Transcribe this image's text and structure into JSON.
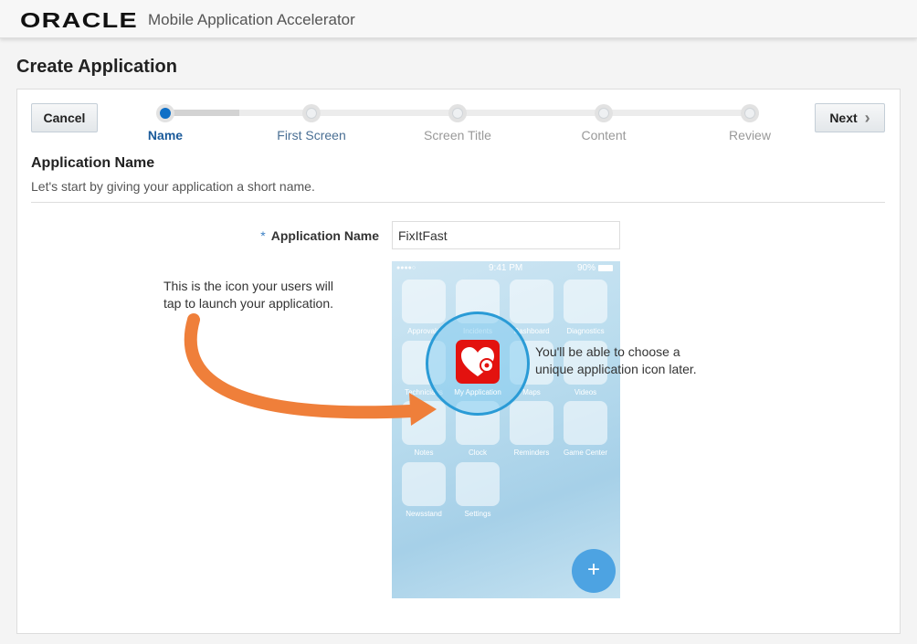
{
  "header": {
    "logo": "ORACLE",
    "title": "Mobile Application Accelerator"
  },
  "page_title": "Create Application",
  "toolbar": {
    "cancel": "Cancel",
    "next": "Next"
  },
  "steps": [
    {
      "label": "Name",
      "active": true
    },
    {
      "label": "First Screen"
    },
    {
      "label": "Screen Title"
    },
    {
      "label": "Content"
    },
    {
      "label": "Review"
    }
  ],
  "section": {
    "title": "Application Name",
    "subtitle": "Let's start by giving your application a short name."
  },
  "form": {
    "required": "*",
    "label": "Application Name",
    "value": "FixItFast"
  },
  "phone": {
    "carrier": "●●●●○",
    "time": "9:41 PM",
    "battery": "90%",
    "apps": [
      "Approvals",
      "Incidents",
      "Dashboard",
      "Diagnostics",
      "Technicians",
      "My Application",
      "Maps",
      "Videos",
      "Notes",
      "Clock",
      "Reminders",
      "Game Center",
      "Newsstand",
      "Settings"
    ],
    "fab": "+"
  },
  "notes": {
    "left": "This is the icon your users will tap to launch your application.",
    "right": "You'll be able to choose a unique application icon later."
  },
  "colors": {
    "accent": "#0f6fc6",
    "arrow": "#ef7f3a",
    "lens": "#2a9bd6",
    "icon": "#e3120f"
  }
}
